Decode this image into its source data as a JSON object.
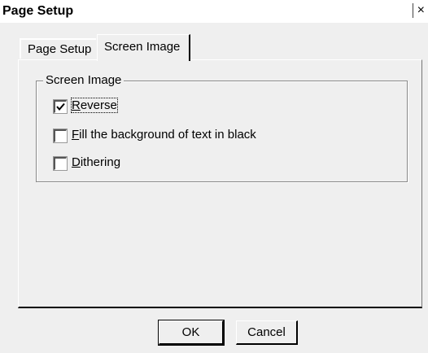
{
  "window": {
    "title": "Page Setup",
    "close_glyph": "×"
  },
  "tabs": [
    {
      "label": "Page Setup",
      "active": false
    },
    {
      "label": "Screen Image",
      "active": true
    }
  ],
  "group": {
    "legend": "Screen Image",
    "options": [
      {
        "label_first": "",
        "label_underlined": "R",
        "label_rest": "everse",
        "checked": true
      },
      {
        "label_first": "",
        "label_underlined": "F",
        "label_rest": "ill the background of text in black",
        "checked": false
      },
      {
        "label_first": "",
        "label_underlined": "D",
        "label_rest": "ithering",
        "checked": false
      }
    ]
  },
  "buttons": {
    "ok_label": "OK",
    "cancel_label": "Cancel"
  }
}
